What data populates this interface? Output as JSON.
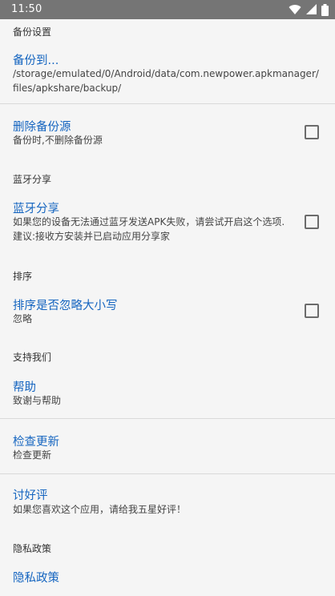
{
  "status_bar": {
    "time": "11:50",
    "icons": [
      "wifi-icon",
      "signal-icon",
      "battery-icon"
    ]
  },
  "sections": {
    "backup": {
      "category": "备份设置",
      "backup_to": {
        "title": "备份到...",
        "path": "/storage/emulated/0/Android/data/com.newpower.apkmanager/files/apkshare/backup/"
      },
      "delete_backup_source": {
        "title": "删除备份源",
        "summary": "备份时,不删除备份源",
        "checked": false
      }
    },
    "bluetooth": {
      "category": "蓝牙分享",
      "share": {
        "title": "蓝牙分享",
        "summary": "如果您的设备无法通过蓝牙发送APK失败，请尝试开启这个选项. 建议:接收方安装并已启动应用分享家",
        "checked": false
      }
    },
    "sort": {
      "category": "排序",
      "ignore_case": {
        "title": "排序是否忽略大小写",
        "summary": "忽略",
        "checked": false
      }
    },
    "support": {
      "category": "支持我们",
      "help": {
        "title": "帮助",
        "summary": "致谢与帮助"
      },
      "check_update": {
        "title": "检查更新",
        "summary": "检查更新"
      },
      "review": {
        "title": "讨好评",
        "summary": "如果您喜欢这个应用，请给我五星好评！"
      }
    },
    "privacy": {
      "category": "隐私政策",
      "policy": {
        "title": "隐私政策"
      }
    }
  },
  "colors": {
    "accent": "#1565c0",
    "statusbar": "#757575",
    "background": "#f5f5f5"
  }
}
